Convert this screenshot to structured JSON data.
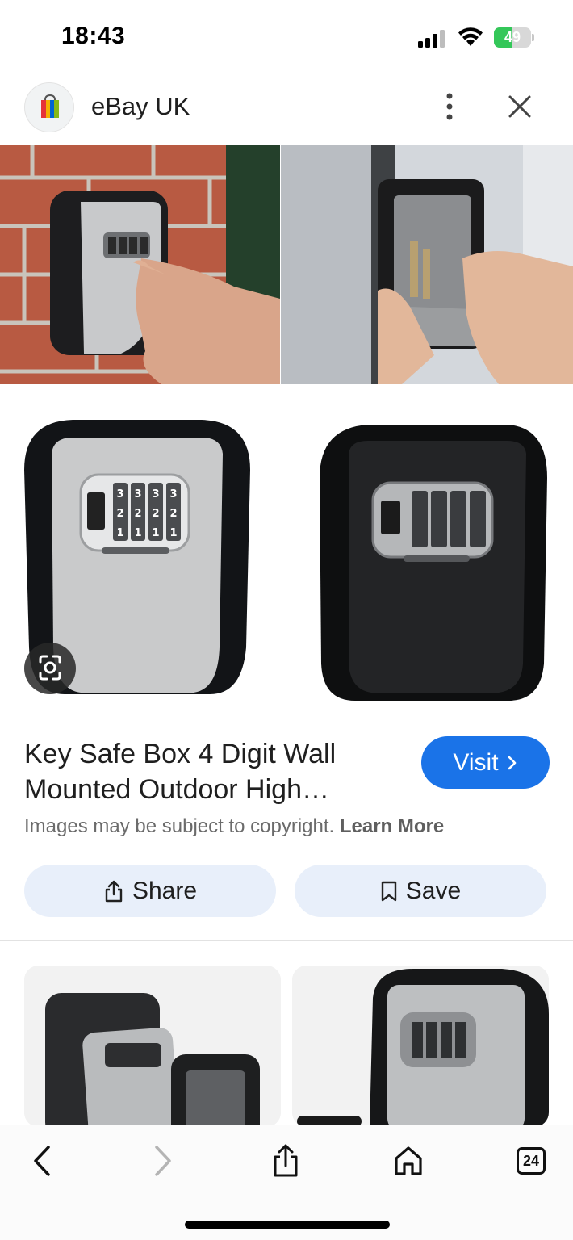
{
  "status_bar": {
    "time": "18:43",
    "battery_percent": "49",
    "battery_level": 0.49,
    "battery_color": "#34c759"
  },
  "header": {
    "site_name": "eBay UK",
    "logo_icon": "ebay-shopping-bag-icon"
  },
  "result": {
    "title": "Key Safe Box 4 Digit Wall Mounted Outdoor High…",
    "visit_label": "Visit",
    "copyright_text": "Images may be subject to copyright.",
    "learn_more_label": "Learn More",
    "share_label": "Share",
    "save_label": "Save"
  },
  "keypad_digits": {
    "row1": "3",
    "row2": "2",
    "row3": "1"
  },
  "toolbar": {
    "tabs_count": "24"
  },
  "colors": {
    "accent": "#1a73e8",
    "action_bg": "#e8effa",
    "brick": "#b5523b"
  }
}
